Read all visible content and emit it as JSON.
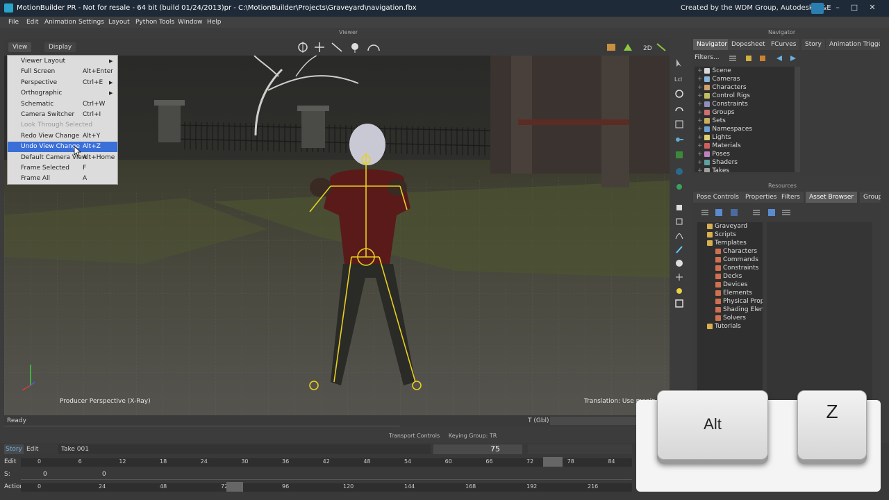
{
  "window": {
    "title": "MotionBuilder PR - Not for resale   - 64 bit (build 01/24/2013)pr  - C:\\MotionBuilder\\Projects\\Graveyard\\navigation.fbx",
    "credit": "Created by the WDM Group, Autodesk M&E",
    "controls": [
      "–",
      "□",
      "✕"
    ]
  },
  "menubar": [
    "File",
    "Edit",
    "Animation",
    "Settings",
    "Layout",
    "Python Tools",
    "Window",
    "Help"
  ],
  "viewer": {
    "label": "Viewer",
    "view_button": "View",
    "display_button": "Display",
    "camera_label": "Producer Perspective (X-Ray)",
    "hint": "Translation: Use manip"
  },
  "view_menu": [
    {
      "label": "Viewer Layout",
      "shortcut": "",
      "submenu": true,
      "state": "normal"
    },
    {
      "label": "Full Screen",
      "shortcut": "Alt+Enter",
      "submenu": false,
      "state": "normal"
    },
    {
      "label": "Perspective",
      "shortcut": "Ctrl+E",
      "submenu": true,
      "state": "normal"
    },
    {
      "label": "Orthographic",
      "shortcut": "",
      "submenu": true,
      "state": "normal"
    },
    {
      "label": "Schematic",
      "shortcut": "Ctrl+W",
      "submenu": false,
      "state": "normal"
    },
    {
      "label": "Camera Switcher",
      "shortcut": "Ctrl+I",
      "submenu": false,
      "state": "normal"
    },
    {
      "label": "Look Through Selected",
      "shortcut": "",
      "submenu": false,
      "state": "disabled"
    },
    {
      "label": "Redo View Change",
      "shortcut": "Alt+Y",
      "submenu": false,
      "state": "normal"
    },
    {
      "label": "Undo View Change",
      "shortcut": "Alt+Z",
      "submenu": false,
      "state": "selected"
    },
    {
      "label": "Default Camera View",
      "shortcut": "Alt+Home",
      "submenu": false,
      "state": "normal"
    },
    {
      "label": "Frame Selected",
      "shortcut": "F",
      "submenu": false,
      "state": "normal"
    },
    {
      "label": "Frame All",
      "shortcut": "A",
      "submenu": false,
      "state": "normal"
    }
  ],
  "navigator": {
    "label": "Navigator",
    "tabs": [
      "Navigator",
      "Dopesheet",
      "FCurves",
      "Story",
      "Animation Trigge"
    ],
    "active_tab": "Navigator",
    "filters_label": "Filters...",
    "tree": [
      {
        "label": "Scene",
        "color": "#d8d8d8"
      },
      {
        "label": "Cameras",
        "color": "#8ab4d8"
      },
      {
        "label": "Characters",
        "color": "#d0a070"
      },
      {
        "label": "Control Rigs",
        "color": "#c0c060"
      },
      {
        "label": "Constraints",
        "color": "#9090c0"
      },
      {
        "label": "Groups",
        "color": "#d07070"
      },
      {
        "label": "Sets",
        "color": "#c8b060"
      },
      {
        "label": "Namespaces",
        "color": "#70a0d0"
      },
      {
        "label": "Lights",
        "color": "#e0d070"
      },
      {
        "label": "Materials",
        "color": "#d06060"
      },
      {
        "label": "Poses",
        "color": "#c080c0"
      },
      {
        "label": "Shaders",
        "color": "#60a0a0"
      },
      {
        "label": "Takes",
        "color": "#a0a0a0"
      }
    ]
  },
  "resources": {
    "label": "Resources",
    "tabs": [
      "Pose Controls",
      "Properties",
      "Filters",
      "Asset Browser",
      "Group"
    ],
    "active_tab": "Asset Browser",
    "tree": [
      {
        "label": "Graveyard",
        "indent": 0,
        "color": "#d8b050"
      },
      {
        "label": "Scripts",
        "indent": 0,
        "color": "#d8b050"
      },
      {
        "label": "Templates",
        "indent": 0,
        "color": "#d8b050"
      },
      {
        "label": "Characters",
        "indent": 1,
        "color": "#d07050"
      },
      {
        "label": "Commands",
        "indent": 1,
        "color": "#d07050"
      },
      {
        "label": "Constraints",
        "indent": 1,
        "color": "#d07050"
      },
      {
        "label": "Decks",
        "indent": 1,
        "color": "#d07050"
      },
      {
        "label": "Devices",
        "indent": 1,
        "color": "#d07050"
      },
      {
        "label": "Elements",
        "indent": 1,
        "color": "#d07050"
      },
      {
        "label": "Physical Proper",
        "indent": 1,
        "color": "#d07050"
      },
      {
        "label": "Shading Eleme",
        "indent": 1,
        "color": "#d07050"
      },
      {
        "label": "Solvers",
        "indent": 1,
        "color": "#d07050"
      },
      {
        "label": "Tutorials",
        "indent": 0,
        "color": "#d8b050"
      }
    ]
  },
  "status": {
    "text": "Ready",
    "gbl": "T (Gbl)"
  },
  "transport": {
    "label": "Transport Controls",
    "keying_group": "Keying Group: TR",
    "story_tab": "Story",
    "edit_tab": "Edit",
    "take": "Take 001",
    "frame_display": "75",
    "edit_label": "Edit",
    "s_label": "S:",
    "s_value": "0",
    "s_value2": "0",
    "action_label": "Action",
    "top_ticks": [
      "0",
      "6",
      "12",
      "18",
      "24",
      "30",
      "36",
      "42",
      "48",
      "54",
      "60",
      "66",
      "72",
      "78",
      "84"
    ],
    "bottom_ticks": [
      "0",
      "24",
      "48",
      "72",
      "96",
      "120",
      "144",
      "168",
      "192",
      "216"
    ]
  },
  "keys": {
    "alt": "Alt",
    "z": "Z"
  }
}
